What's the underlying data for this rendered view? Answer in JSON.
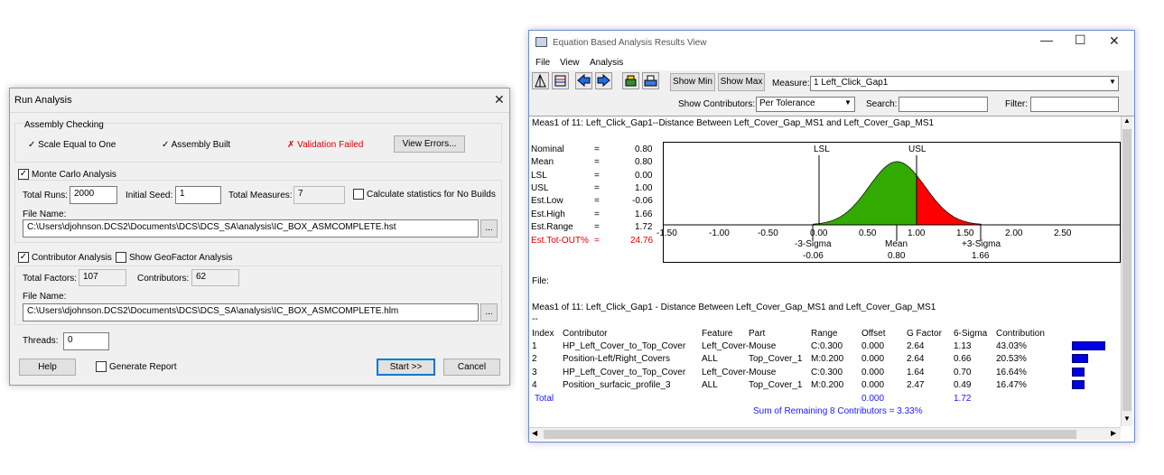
{
  "run_analysis": {
    "title": "Run Analysis",
    "assembly_checking": {
      "group_label": "Assembly Checking",
      "scale_check": "✓ Scale Equal to One",
      "built_check": "✓ Assembly Built",
      "validation": "✗ Validation Failed",
      "view_errors_button": "View Errors..."
    },
    "monte_carlo": {
      "checkbox_label": "Monte Carlo Analysis",
      "checked": true,
      "total_runs_label": "Total Runs:",
      "total_runs_value": "2000",
      "initial_seed_label": "Initial Seed:",
      "initial_seed_value": "1",
      "total_measures_label": "Total Measures:",
      "total_measures_value": "7",
      "calc_no_builds_label": "Calculate statistics for No Builds",
      "file_name_label": "File Name:",
      "file_name_value": "C:\\Users\\djohnson.DCS2\\Documents\\DCS\\DCS_SA\\analysis\\IC_BOX_ASMCOMPLETE.hst",
      "browse_button": "..."
    },
    "contributor": {
      "checkbox_label": "Contributor Analysis",
      "checked": true,
      "geofactor_label": "Show GeoFactor Analysis",
      "total_factors_label": "Total Factors:",
      "total_factors_value": "107",
      "contributors_label": "Contributors:",
      "contributors_value": "62",
      "file_name_label": "File Name:",
      "file_name_value": "C:\\Users\\djohnson.DCS2\\Documents\\DCS\\DCS_SA\\analysis\\IC_BOX_ASMCOMPLETE.hlm",
      "browse_button": "..."
    },
    "threads_label": "Threads:",
    "threads_value": "0",
    "help_button": "Help",
    "generate_report_label": "Generate Report",
    "start_button": "Start >>",
    "cancel_button": "Cancel",
    "close_glyph": "✕"
  },
  "results": {
    "title": "Equation Based Analysis Results View",
    "menu": [
      "File",
      "View",
      "Analysis"
    ],
    "show_min_button": "Show Min",
    "show_max_button": "Show Max",
    "measure_label": "Measure:",
    "measure_value": "1 Left_Click_Gap1",
    "show_contributors_label": "Show Contributors:",
    "show_contributors_value": "Per Tolerance",
    "search_label": "Search:",
    "filter_label": "Filter:",
    "header_line": "Meas1 of 11: Left_Click_Gap1--Distance Between Left_Cover_Gap_MS1 and Left_Cover_Gap_MS1",
    "stats": [
      {
        "name": "Nominal",
        "eq": "=",
        "value": "0.80"
      },
      {
        "name": "Mean",
        "eq": "=",
        "value": "0.80"
      },
      {
        "name": "LSL",
        "eq": "=",
        "value": "0.00"
      },
      {
        "name": "USL",
        "eq": "=",
        "value": "1.00"
      },
      {
        "name": "Est.Low",
        "eq": "=",
        "value": "-0.06"
      },
      {
        "name": "Est.High",
        "eq": "=",
        "value": "1.66"
      },
      {
        "name": "Est.Range",
        "eq": "=",
        "value": "1.72"
      },
      {
        "name": "Est.Tot-OUT%",
        "eq": "=",
        "value": "24.76"
      }
    ],
    "chart": {
      "lsl_label": "LSL",
      "usl_label": "USL",
      "ticks": [
        "-1.50",
        "-1.00",
        "-0.50",
        "0.00",
        "0.50",
        "1.00",
        "1.50",
        "2.00",
        "2.50"
      ],
      "minus3_label": "-3-Sigma",
      "minus3_value": "-0.06",
      "mean_label": "Mean",
      "mean_value": "0.80",
      "plus3_label": "+3-Sigma",
      "plus3_value": "1.66",
      "in_color": "#33aa00",
      "out_color": "#ff0000"
    },
    "file_label": "File:",
    "contrib_header": "Meas1 of 11: Left_Click_Gap1 - Distance Between Left_Cover_Gap_MS1 and Left_Cover_Gap_MS1",
    "dashes": "--",
    "columns": [
      "Index",
      "Contributor",
      "Feature",
      "Part",
      "Range",
      "Offset",
      "G Factor",
      "6-Sigma",
      "Contribution"
    ],
    "rows": [
      {
        "index": "1",
        "contributor": "HP_Left_Cover_to_Top_Cover",
        "feature": "Left_Cover-Mouse",
        "part": "",
        "range": "C:0.300",
        "offset": "0.000",
        "gfactor": "2.64",
        "sigma": "1.13",
        "contribution": "43.03%",
        "pct": 43.03
      },
      {
        "index": "2",
        "contributor": "Position-Left/Right_Covers",
        "feature": "ALL",
        "part": "Top_Cover_1",
        "range": "M:0.200",
        "offset": "0.000",
        "gfactor": "2.64",
        "sigma": "0.66",
        "contribution": "20.53%",
        "pct": 20.53
      },
      {
        "index": "3",
        "contributor": "HP_Left_Cover_to_Top_Cover",
        "feature": "Left_Cover-Mouse",
        "part": "",
        "range": "C:0.300",
        "offset": "0.000",
        "gfactor": "1.64",
        "sigma": "0.70",
        "contribution": "16.64%",
        "pct": 16.64
      },
      {
        "index": "4",
        "contributor": "Position_surfacic_profile_3",
        "feature": "ALL",
        "part": "Top_Cover_1",
        "range": "M:0.200",
        "offset": "0.000",
        "gfactor": "2.47",
        "sigma": "0.49",
        "contribution": "16.47%",
        "pct": 16.47
      }
    ],
    "total_label": "Total",
    "total_offset": "0.000",
    "total_sigma": "1.72",
    "remaining": "Sum of Remaining 8 Contributors = 3.33%",
    "blue_text_color": "#1a1aff"
  }
}
